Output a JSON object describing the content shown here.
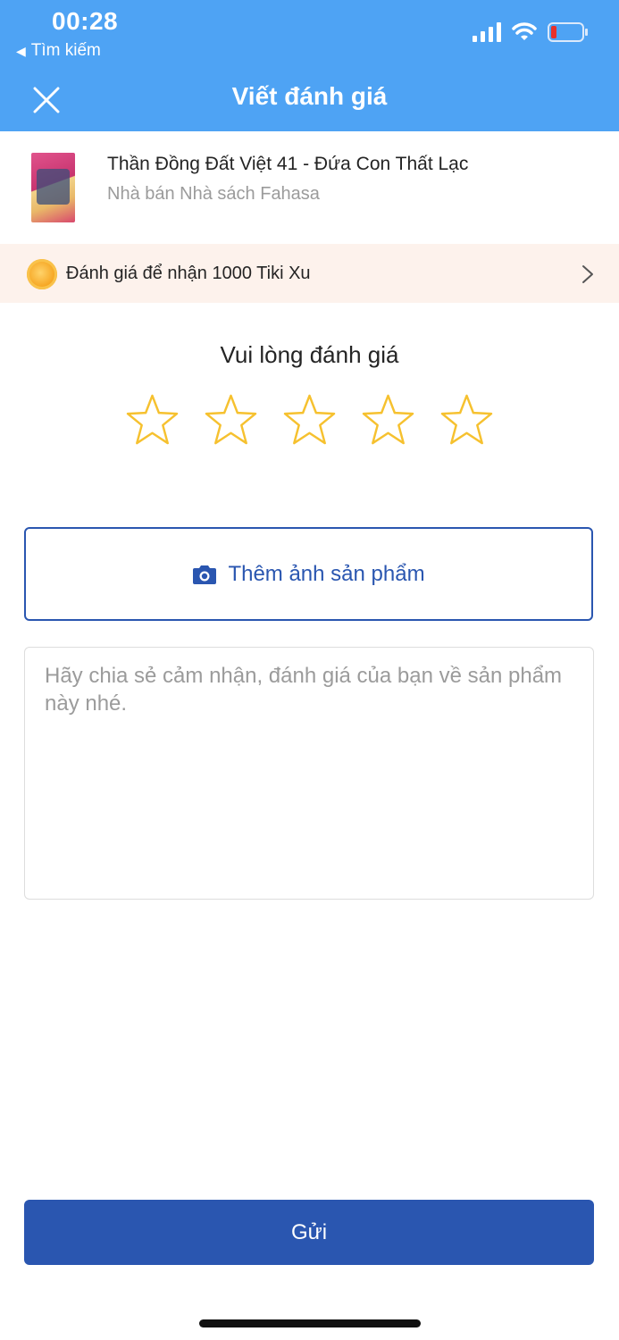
{
  "status_bar": {
    "time": "00:28",
    "back_app": "Tìm kiếm",
    "back_icon": "triangle-left-icon",
    "signal_icon": "cellular-signal-icon",
    "wifi_icon": "wifi-icon",
    "battery_icon": "battery-low-icon",
    "battery_level": 0.15
  },
  "header": {
    "title": "Viết đánh giá",
    "close_icon": "close-icon",
    "background": "#4ea3f4"
  },
  "product": {
    "name": "Thần Đồng Đất Việt 41 - Đứa Con Thất Lạc",
    "seller": "Nhà bán Nhà sách Fahasa"
  },
  "reward": {
    "text": "Đánh giá để nhận 1000 Tiki Xu",
    "icon": "coin-icon",
    "chevron_icon": "chevron-right-icon",
    "background": "#fdf2ec"
  },
  "rating": {
    "prompt": "Vui lòng đánh giá",
    "max_stars": 5,
    "selected": 0,
    "star_color": "#f6c12f"
  },
  "photo_button": {
    "label": "Thêm ảnh sản phẩm",
    "icon": "camera-icon",
    "color": "#2a56b0"
  },
  "comment": {
    "value": "",
    "placeholder": "Hãy chia sẻ cảm nhận, đánh giá của bạn về sản phẩm này nhé."
  },
  "submit": {
    "label": "Gửi",
    "color": "#2a56b0"
  }
}
